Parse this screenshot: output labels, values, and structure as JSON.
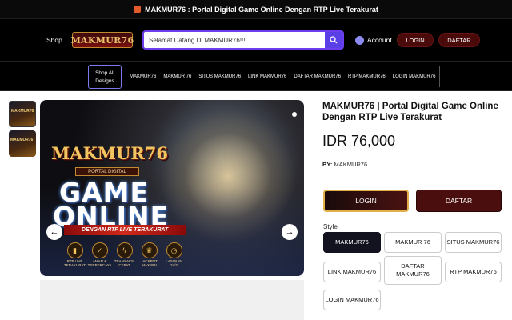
{
  "announcement": {
    "icon": "gift-icon",
    "text": "MAKMUR76 :  Portal Digital Game Online Dengan RTP Live Terakurat"
  },
  "header": {
    "shop_label": "Shop",
    "logo_text": "MAKMUR76",
    "search_value": "Selamat Datang Di MAKMUR76!!!",
    "account_label": "Account",
    "login_label": "LOGIN",
    "daftar_label": "DAFTAR"
  },
  "nav": {
    "all_designs_label": "Shop All Designs",
    "items": [
      "MAKMUR76",
      "MAKMUR 76",
      "SITUS MAKMUR76",
      "LINK MAKMUR76",
      "DAFTAR MAKMUR76",
      "RTP MAKMUR76",
      "LOGIN MAKMUR76"
    ]
  },
  "hero": {
    "brand": "MAKMUR76",
    "sub_brand": "PORTAL DIGITAL",
    "line1": "GAME",
    "line2": "ONLINE",
    "tagline": "DENGAN RTP LIVE TERAKURAT",
    "features": [
      {
        "label": "RTP LIVE TERAKURAT",
        "icon": "chart-icon"
      },
      {
        "label": "AMAN & TERPERCAYA",
        "icon": "shield-icon"
      },
      {
        "label": "TRANSAKSI CEPAT",
        "icon": "bolt-icon"
      },
      {
        "label": "JACKPOT MAXWIN",
        "icon": "trophy-icon"
      },
      {
        "label": "LAYANAN 24/7",
        "icon": "clock-icon"
      }
    ]
  },
  "product": {
    "title": "MAKMUR76 | Portal Digital Game Online Dengan RTP Live Terakurat",
    "price": "IDR 76,000",
    "by_label": "BY:",
    "by_value": "MAKMUR76.",
    "login_label": "LOGIN",
    "daftar_label": "DAFTAR",
    "style_label": "Style",
    "options": [
      "MAKMUR76",
      "MAKMUR 76",
      "SITUS MAKMUR76",
      "LINK MAKMUR76",
      "DAFTAR MAKMUR76",
      "RTP MAKMUR76",
      "LOGIN MAKMUR76"
    ],
    "selected_option": "MAKMUR76"
  },
  "colors": {
    "accent": "#5a3fe6",
    "dark_red": "#4a0e0e",
    "gold": "#e2b04a"
  }
}
